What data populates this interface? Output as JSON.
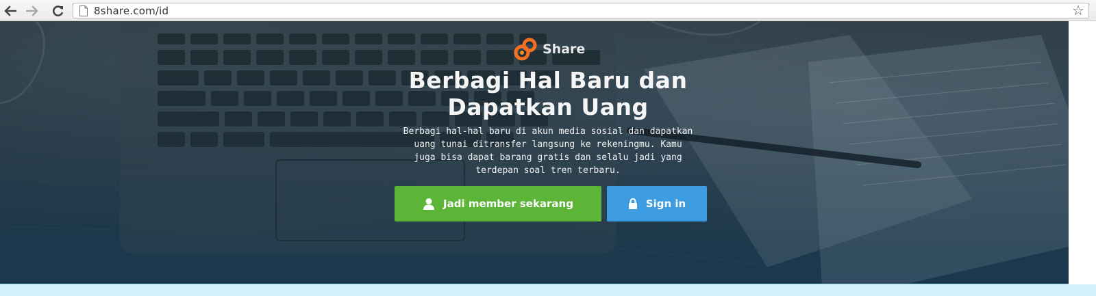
{
  "browser": {
    "url": "8share.com/id",
    "icons": {
      "back": "back-arrow-icon",
      "forward": "forward-arrow-icon",
      "reload": "reload-icon",
      "page": "page-icon",
      "bookmark": "star-icon"
    }
  },
  "hero": {
    "brand_name": "Share",
    "headline_line1": "Berbagi Hal Baru dan",
    "headline_line2": "Dapatkan Uang",
    "subtitle_line1": "Berbagi hal-hal baru di akun media sosial dan dapatkan",
    "subtitle_line2": "uang tunai ditransfer langsung ke rekeningmu. Kamu",
    "subtitle_line3": "juga bisa dapat barang gratis dan selalu jadi yang",
    "subtitle_line4": "terdepan soal tren terbaru.",
    "join_label": "Jadi member sekarang",
    "signin_label": "Sign in"
  },
  "colors": {
    "join_button": "#5cb536",
    "signin_button": "#3e9de0",
    "logo_orange": "#f37021",
    "bottom_strip": "#d2f0fb"
  }
}
